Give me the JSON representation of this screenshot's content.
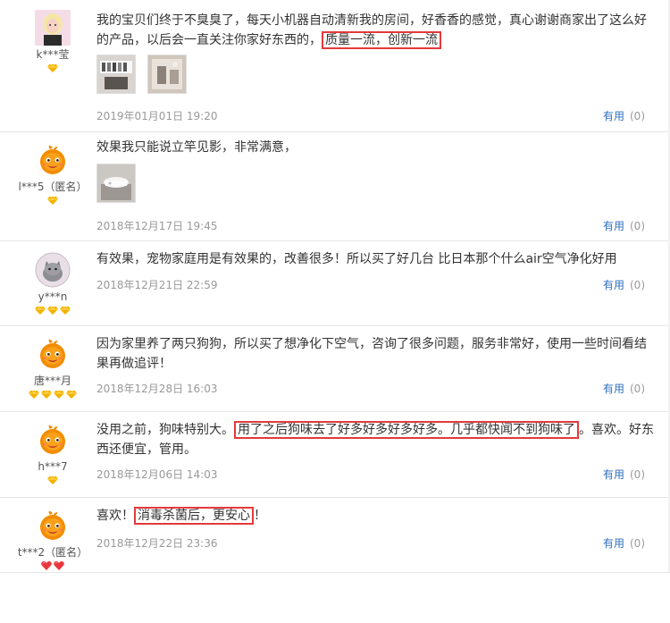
{
  "useful_label": "有用",
  "reviews": [
    {
      "user": "k***莹",
      "avatar": "photo-avatar",
      "level": "gold-diamond-1",
      "text_before": "我的宝贝们终于不臭臭了，每天小机器自动清新我的房间，好香香的感觉，真心谢谢商家出了这么好的产品，以后会一直关注你家好东西的，",
      "text_highlight": "质量一流，创新一流",
      "text_after": "",
      "date": "2019年01月01日 19:20",
      "useful_count": "(0)"
    },
    {
      "user": "l***5（匿名）",
      "avatar": "default-orange-avatar",
      "level": "gold-diamond-1",
      "text_before": "效果我只能说立竿见影，非常满意，",
      "text_highlight": "",
      "text_after": "",
      "date": "2018年12月17日 19:45",
      "useful_count": "(0)"
    },
    {
      "user": "y***n",
      "avatar": "cat-avatar",
      "level": "gold-diamond-3",
      "text_before": "有效果，宠物家庭用是有效果的，改善很多！所以买了好几台 比日本那个什么air空气净化好用",
      "text_highlight": "",
      "text_after": "",
      "date": "2018年12月21日 22:59",
      "useful_count": "(0)"
    },
    {
      "user": "唐***月",
      "avatar": "default-orange-avatar",
      "level": "gold-diamond-4",
      "text_before": "因为家里养了两只狗狗，所以买了想净化下空气，咨询了很多问题，服务非常好，使用一些时间看结果再做追评！",
      "text_highlight": "",
      "text_after": "",
      "date": "2018年12月28日 16:03",
      "useful_count": "(0)"
    },
    {
      "user": "h***7",
      "avatar": "default-orange-avatar",
      "level": "gold-diamond-1",
      "text_before": "没用之前，狗味特别大。",
      "text_highlight": "用了之后狗味去了好多好多好多好多。几乎都快闻不到狗味了",
      "text_after": "。喜欢。好东西还便宜，管用。",
      "date": "2018年12月06日 14:03",
      "useful_count": "(0)"
    },
    {
      "user": "t***2（匿名）",
      "avatar": "default-orange-avatar",
      "level": "red-heart-2",
      "text_before": "喜欢！",
      "text_highlight": "消毒杀菌后，更安心",
      "text_after": "！",
      "date": "2018年12月22日 23:36",
      "useful_count": "(0)"
    }
  ]
}
